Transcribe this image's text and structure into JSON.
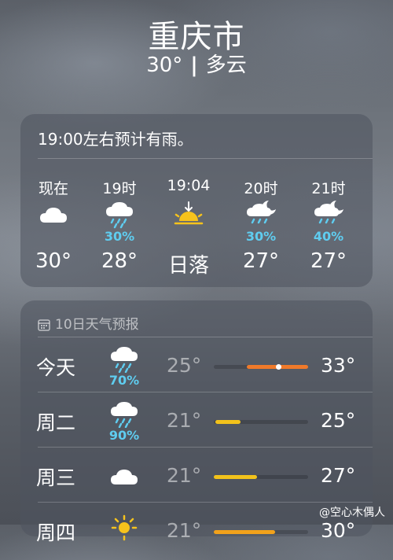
{
  "header": {
    "city": "重庆市",
    "temp": "30°",
    "separator": "|",
    "condition": "多云"
  },
  "hourly": {
    "alert": "19:00左右预计有雨。",
    "items": [
      {
        "label": "现在",
        "icon": "cloud-icon",
        "pct": "",
        "temp": "30°"
      },
      {
        "label": "19时",
        "icon": "rain-cloud-icon",
        "pct": "30%",
        "temp": "28°"
      },
      {
        "label": "19:04",
        "icon": "sunset-icon",
        "pct": "",
        "temp": "日落"
      },
      {
        "label": "20时",
        "icon": "moon-rain-cloud-icon",
        "pct": "30%",
        "temp": "27°"
      },
      {
        "label": "21时",
        "icon": "moon-rain-cloud-icon",
        "pct": "40%",
        "temp": "27°"
      }
    ]
  },
  "forecast": {
    "title": "10日天气预报",
    "days": [
      {
        "day": "今天",
        "icon": "rain-cloud-icon",
        "pct": "70%",
        "low": "25°",
        "high": "33°",
        "bar_start": 0.35,
        "bar_end": 1.0,
        "bar_color": "#f07a2a",
        "current": 0.68
      },
      {
        "day": "周二",
        "icon": "rain-cloud-icon",
        "pct": "90%",
        "low": "21°",
        "high": "25°",
        "bar_start": 0.02,
        "bar_end": 0.28,
        "bar_color": "#f2c21b"
      },
      {
        "day": "周三",
        "icon": "cloud-icon",
        "pct": "",
        "low": "21°",
        "high": "27°",
        "bar_start": 0.0,
        "bar_end": 0.46,
        "bar_color": "#f2c21b"
      },
      {
        "day": "周四",
        "icon": "sun-icon",
        "pct": "",
        "low": "21°",
        "high": "30°",
        "bar_start": 0.0,
        "bar_end": 0.65,
        "bar_color": "#f2a21b"
      }
    ]
  },
  "watermark": "@空心木偶人"
}
